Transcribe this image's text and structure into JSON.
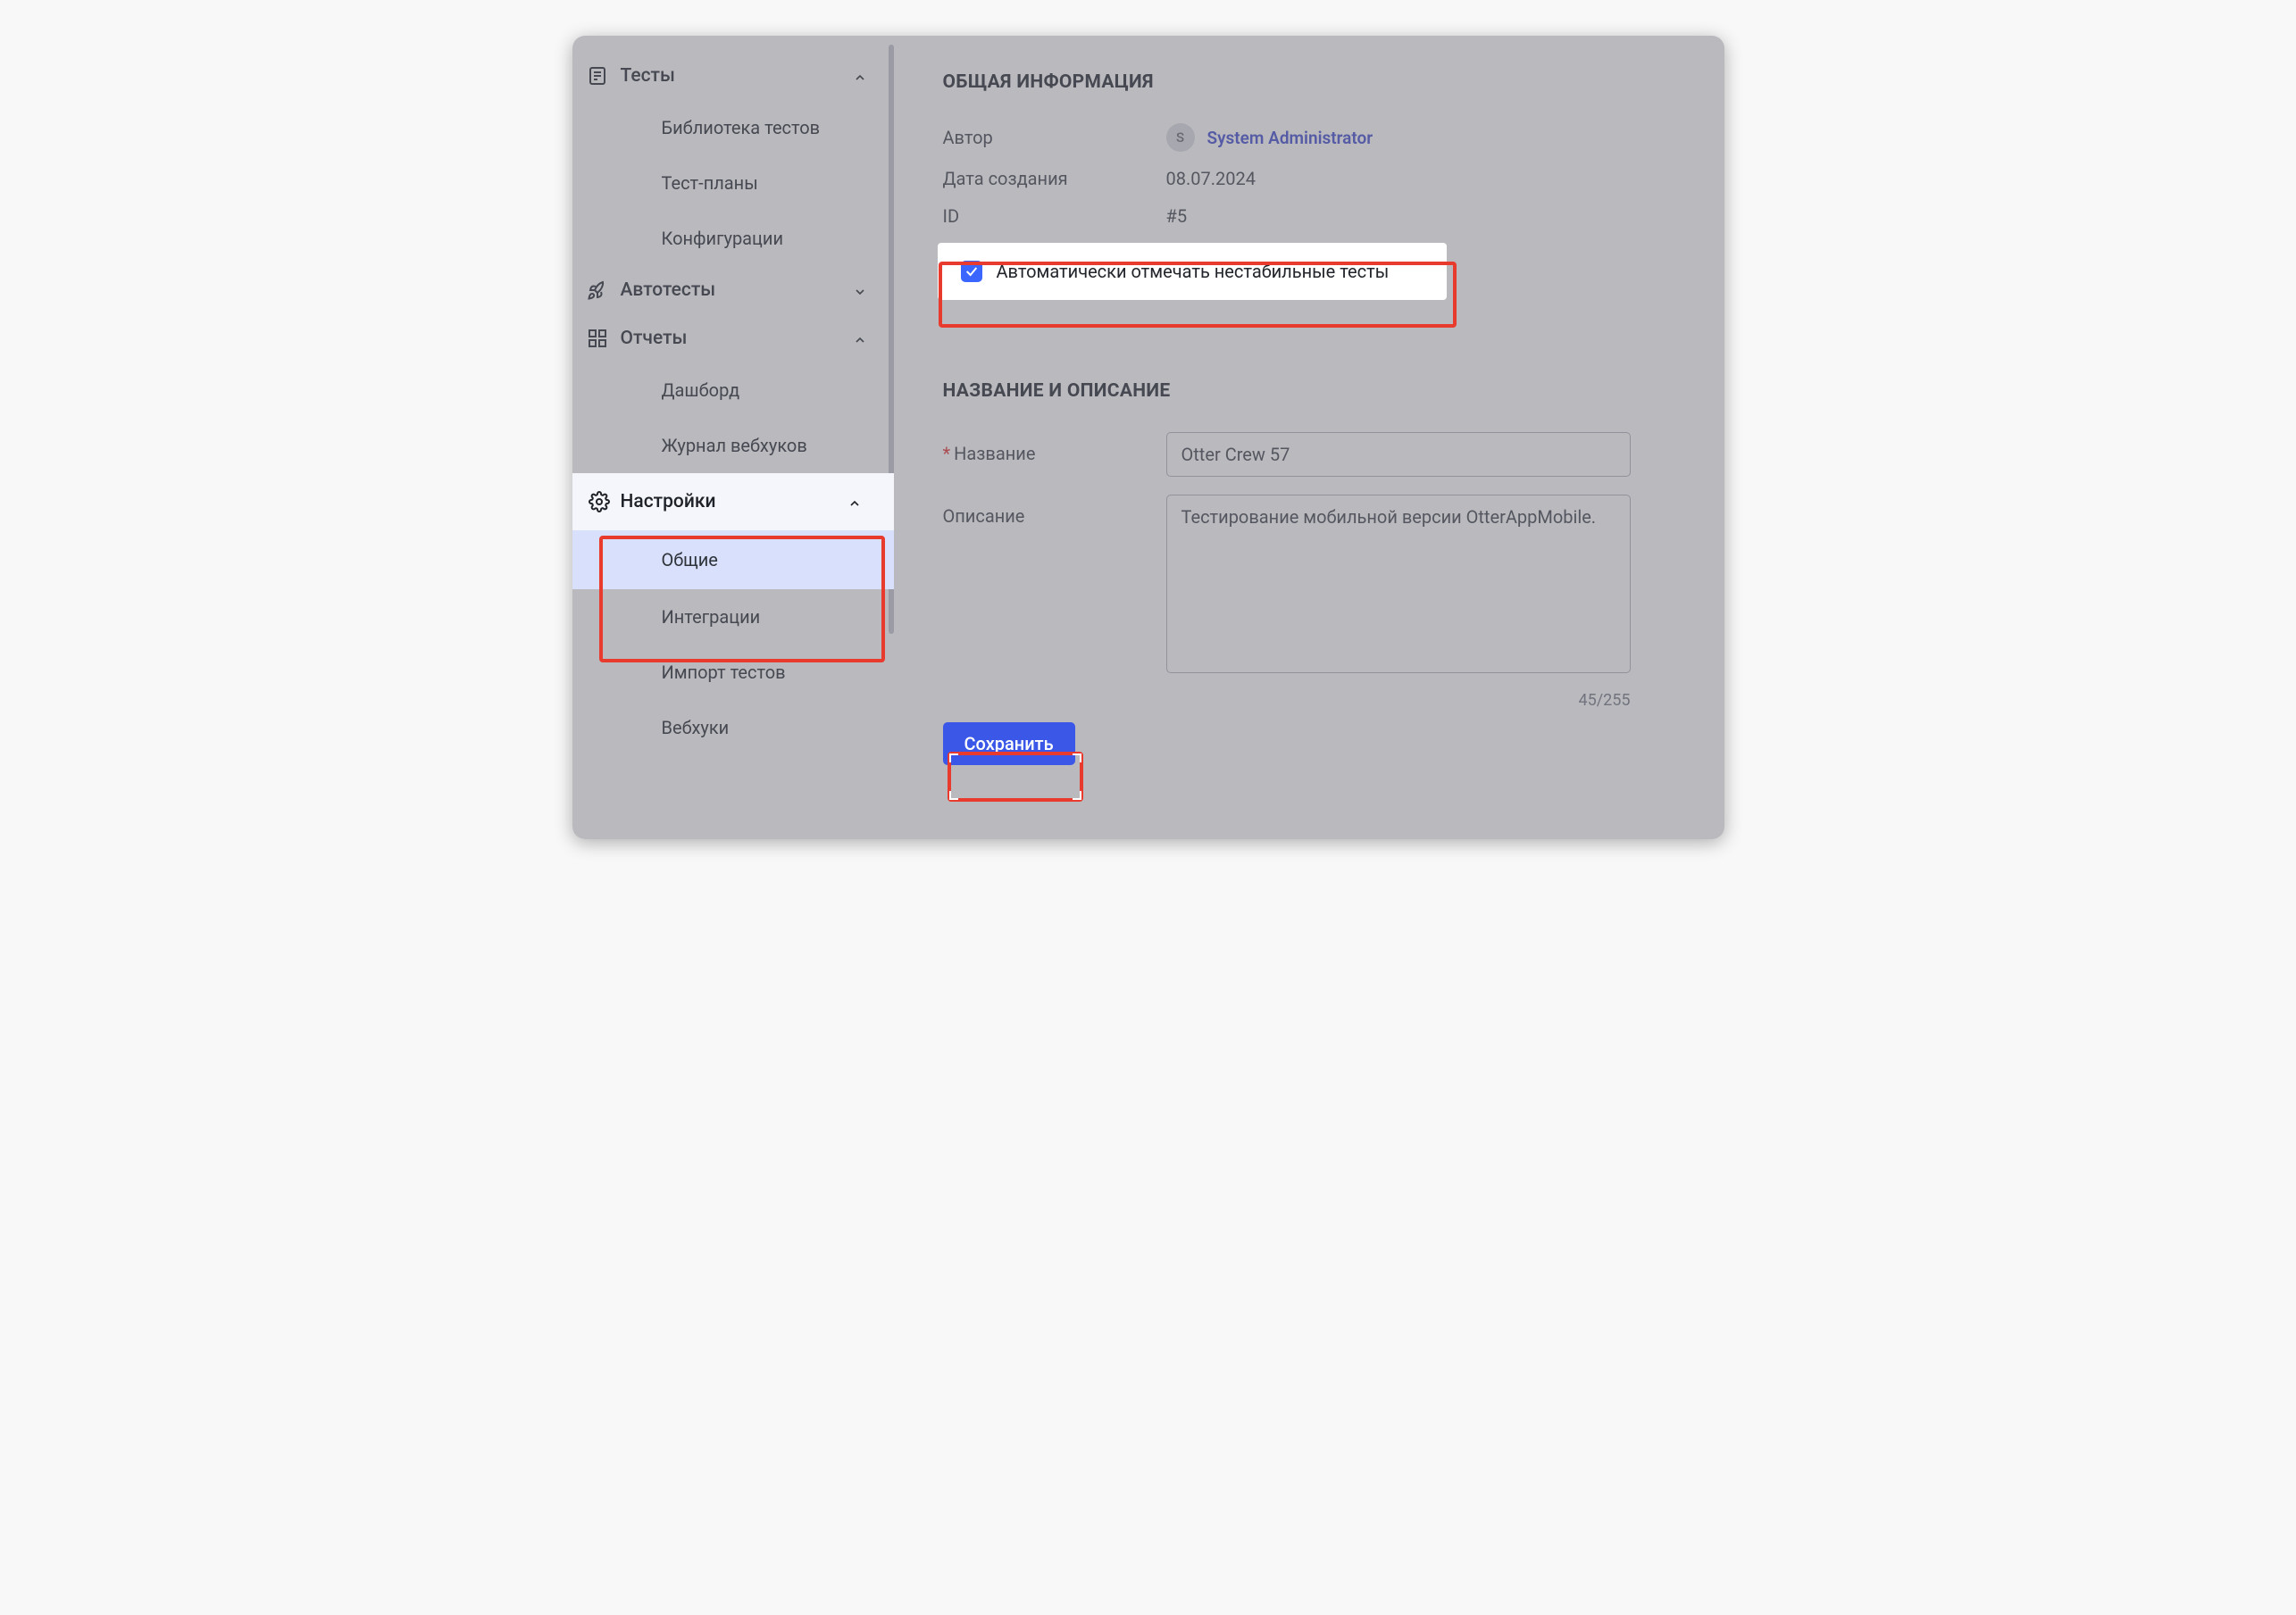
{
  "sidebar": {
    "tests": {
      "label": "Тесты",
      "expanded": true
    },
    "tests_children": {
      "library": "Библиотека тестов",
      "plans": "Тест-планы",
      "configs": "Конфигурации"
    },
    "autotests": {
      "label": "Автотесты",
      "expanded": false
    },
    "reports": {
      "label": "Отчеты",
      "expanded": true
    },
    "reports_children": {
      "dashboard": "Дашборд",
      "webhook_log": "Журнал вебхуков"
    },
    "settings": {
      "label": "Настройки",
      "expanded": true
    },
    "settings_children": {
      "general": "Общие",
      "integrations": "Интеграции",
      "import": "Импорт тестов",
      "webhooks": "Вебхуки"
    }
  },
  "main": {
    "general_info_heading": "ОБЩАЯ ИНФОРМАЦИЯ",
    "author_label": "Автор",
    "author_avatar_initial": "S",
    "author_name": "System Administrator",
    "created_label": "Дата создания",
    "created_value": "08.07.2024",
    "id_label": "ID",
    "id_value": "#5",
    "auto_flaky_checkbox": {
      "checked": true,
      "label": "Автоматически отмечать нестабильные тесты"
    },
    "name_desc_heading": "НАЗВАНИЕ И ОПИСАНИЕ",
    "name_label": "Название",
    "name_value": "Otter Crew 57",
    "desc_label": "Описание",
    "desc_value": "Тестирование мобильной версии OtterAppMobile.",
    "char_count": "45/255",
    "save_label": "Сохранить"
  },
  "colors": {
    "accent_blue": "#3a57e8",
    "checkbox_blue": "#3a66ff",
    "highlight_red": "#e83b2e",
    "link_purple": "#4a55cf",
    "selected_bg": "#d8e0fb"
  }
}
